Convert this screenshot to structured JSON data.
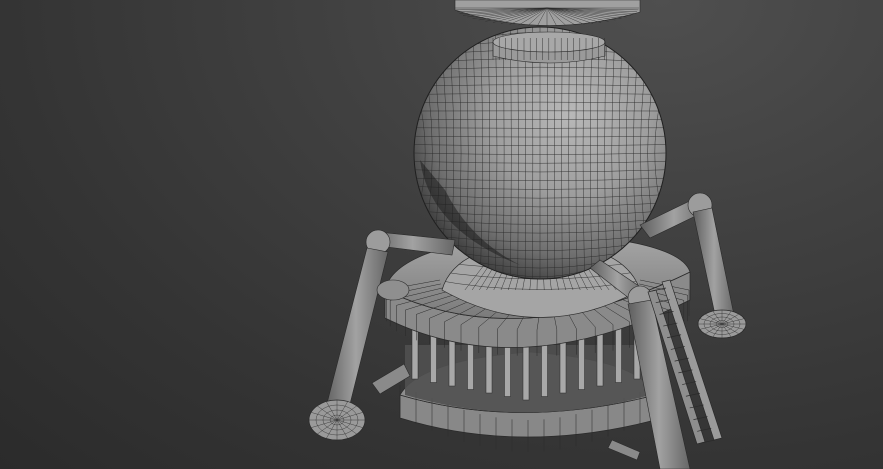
{
  "viewport": {
    "background_colors": [
      "#2e2e2e",
      "#4a4a4a"
    ],
    "shading_mode": "edged-faces",
    "model_base_color": "#9a9a9a",
    "wireframe_color": "#2a2a2a"
  },
  "model": {
    "parts": [
      "top-dish",
      "neck-collar",
      "main-sphere",
      "lower-dome",
      "deck-ring",
      "column-ring",
      "base-ring",
      "leg-left",
      "leg-right-back",
      "leg-front",
      "foot-pad-left",
      "foot-pad-right",
      "ladder"
    ]
  }
}
